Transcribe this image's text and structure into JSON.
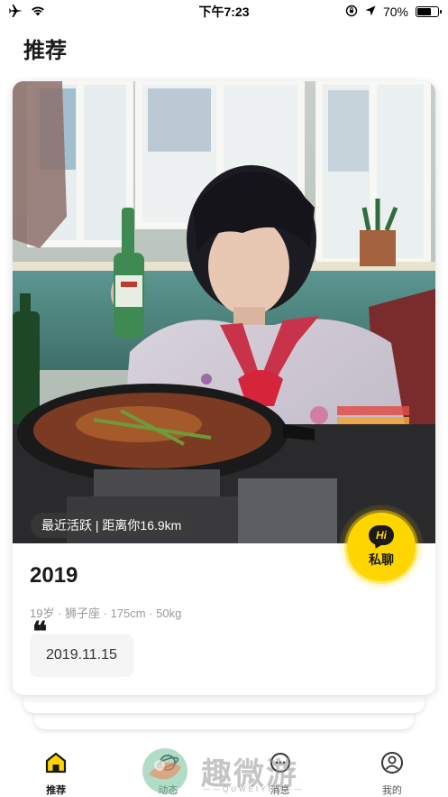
{
  "status_bar": {
    "time": "下午7:23",
    "battery": "70%",
    "battery_level": 0.7,
    "icons": [
      "airplane-icon",
      "wifi-icon",
      "orientation-lock-icon",
      "location-icon",
      "battery-icon"
    ]
  },
  "page": {
    "title": "推荐"
  },
  "card": {
    "activity": "最近活跃 | 距离你16.9km",
    "name": "2019",
    "meta": "19岁 · 狮子座 · 175cm · 50kg",
    "quote_mark": "❝",
    "signature": "2019.11.15",
    "chat_button": {
      "hi": "Hi",
      "label": "私聊",
      "color": "#FFD500"
    }
  },
  "tabs": [
    {
      "label": "推荐",
      "icon": "home-icon",
      "active": true
    },
    {
      "label": "动态",
      "icon": "planet-icon",
      "active": false
    },
    {
      "label": "消息",
      "icon": "message-icon",
      "active": false
    },
    {
      "label": "我的",
      "icon": "profile-icon",
      "active": false
    }
  ],
  "watermark": {
    "text": "趣微游",
    "sub": "——QUWEIYOU——"
  },
  "colors": {
    "accent": "#FFD500",
    "text_primary": "#1a1a1a",
    "text_secondary": "#999999"
  }
}
